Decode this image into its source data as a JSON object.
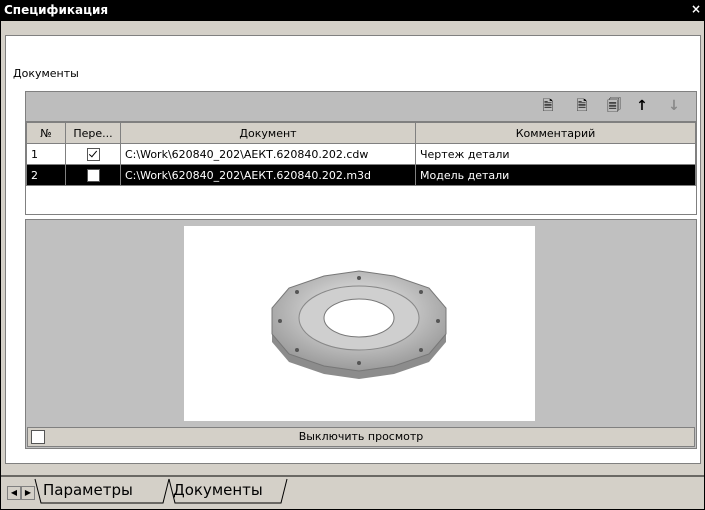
{
  "window": {
    "title": "Спецификация",
    "close_glyph": "×"
  },
  "documents": {
    "label": "Документы",
    "label_underlined_letter": "Д",
    "label_rest": "окументы",
    "toolbar": {
      "buttons": [
        {
          "name": "add-document-icon",
          "glyph": "🗎"
        },
        {
          "name": "add-document-alt-icon",
          "glyph": "🗎"
        },
        {
          "name": "copy-document-icon",
          "glyph": "🗐"
        },
        {
          "name": "arrow-up-icon",
          "glyph": "↑"
        },
        {
          "name": "arrow-down-icon",
          "glyph": "↓"
        }
      ]
    },
    "columns": [
      "№",
      "Пере...",
      "Документ",
      "Комментарий"
    ],
    "rows": [
      {
        "num": "1",
        "checked": true,
        "document": "C:\\Work\\620840_202\\АЕКТ.620840.202.cdw",
        "comment": "Чертеж детали"
      },
      {
        "num": "2",
        "checked": false,
        "document": "C:\\Work\\620840_202\\АЕКТ.620840.202.m3d",
        "comment": "Модель детали"
      }
    ]
  },
  "preview": {
    "toggle_label": "Выключить просмотр"
  },
  "tabs": {
    "params": "Параметры",
    "docs": "Документы"
  },
  "colors": {
    "selection": "#000000",
    "window_bg": "#d4d0c8",
    "titlebar": "#000000"
  }
}
